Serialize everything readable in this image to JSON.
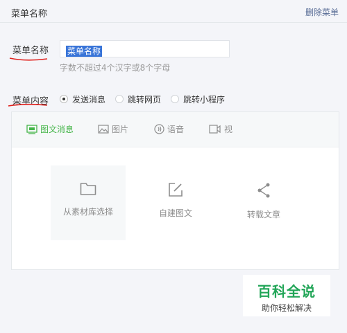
{
  "header": {
    "title": "菜单名称",
    "delete_label": "删除菜单"
  },
  "name_field": {
    "label": "菜单名称",
    "value": "菜单名称",
    "hint": "字数不超过4个汉字或8个字母"
  },
  "content": {
    "label": "菜单内容",
    "options": [
      {
        "label": "发送消息",
        "checked": true
      },
      {
        "label": "跳转网页",
        "checked": false
      },
      {
        "label": "跳转小程序",
        "checked": false
      }
    ]
  },
  "tabs": [
    {
      "label": "图文消息",
      "icon": "article-icon",
      "active": true
    },
    {
      "label": "图片",
      "icon": "image-icon",
      "active": false
    },
    {
      "label": "语音",
      "icon": "voice-icon",
      "active": false
    },
    {
      "label": "视",
      "icon": "video-icon",
      "active": false
    }
  ],
  "actions": [
    {
      "label": "从素材库选择",
      "icon": "folder-icon"
    },
    {
      "label": "自建图文",
      "icon": "edit-icon"
    },
    {
      "label": "转载文章",
      "icon": "share-icon"
    }
  ],
  "watermark": {
    "title": "百科全说",
    "subtitle": "助你轻松解决"
  },
  "colors": {
    "accent": "#44b549",
    "link": "#576b95",
    "annotation": "#e0201c",
    "selection": "#3874d8"
  }
}
